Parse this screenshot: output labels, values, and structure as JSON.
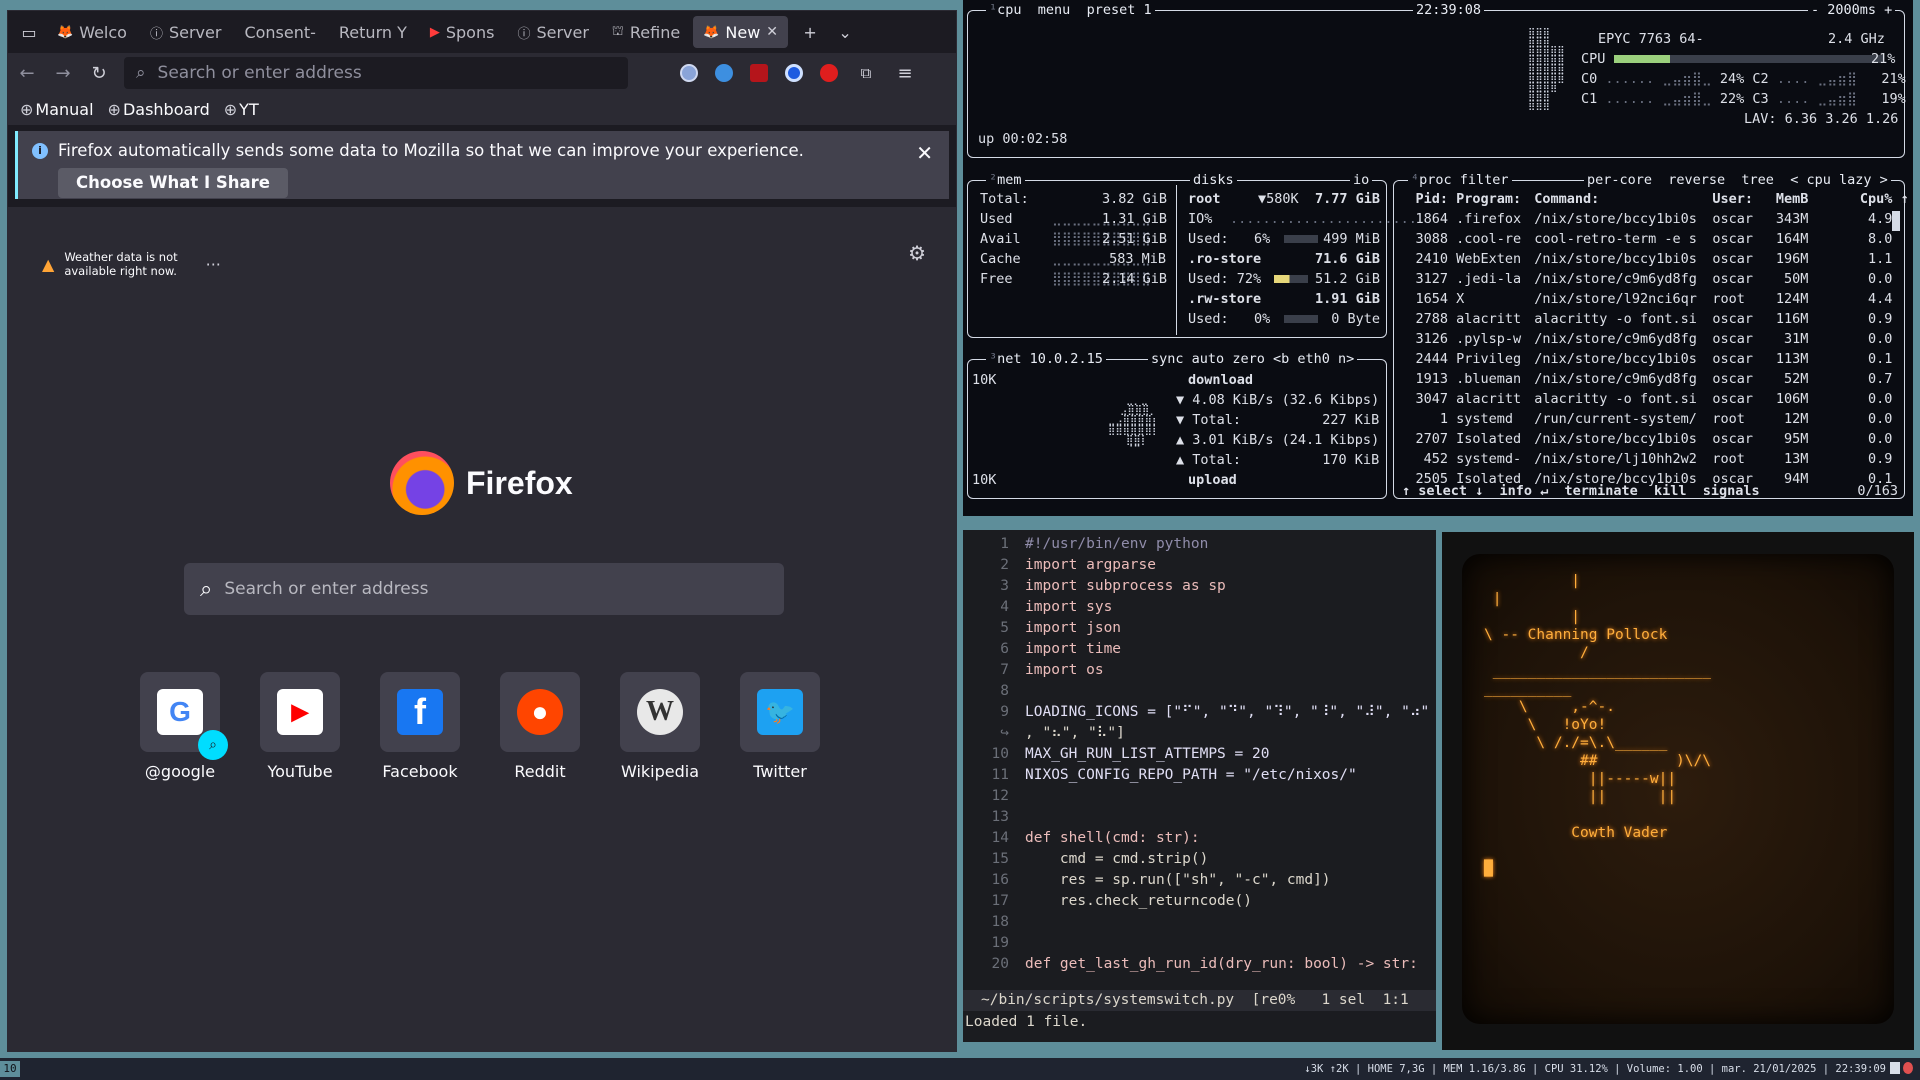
{
  "firefox": {
    "tabs": [
      {
        "label": "Welco",
        "fav": "🦊"
      },
      {
        "label": "Server",
        "fav": "ⓘ"
      },
      {
        "label": "Consent-",
        "fav": ""
      },
      {
        "label": "Return Y",
        "fav": ""
      },
      {
        "label": "Spons",
        "fav": "▶"
      },
      {
        "label": "Server",
        "fav": "ⓘ"
      },
      {
        "label": "Refine",
        "fav": "⛫"
      },
      {
        "label": "New",
        "fav": "🦊"
      }
    ],
    "url_placeholder": "Search or enter address",
    "bookmarks": [
      "Manual",
      "Dashboard",
      "YT"
    ],
    "notification": {
      "text": "Firefox automatically sends some data to Mozilla so that we can improve your experience.",
      "button": "Choose What I Share"
    },
    "weather": {
      "line1": "Weather data is not",
      "line2": "available right now."
    },
    "brand": "Firefox",
    "search_placeholder": "Search or enter address",
    "shortcuts": [
      {
        "label": "@google",
        "icon": "G",
        "color": "#ffffff",
        "fg": "#4285f4"
      },
      {
        "label": "YouTube",
        "icon": "▶",
        "color": "#ffffff",
        "fg": "#ff0000"
      },
      {
        "label": "Facebook",
        "icon": "f",
        "color": "#1877f2",
        "fg": "#ffffff"
      },
      {
        "label": "Reddit",
        "icon": "●",
        "color": "#ff4500",
        "fg": "#ffffff"
      },
      {
        "label": "Wikipedia",
        "icon": "W",
        "color": "#e8e8e8",
        "fg": "#333333"
      },
      {
        "label": "Twitter",
        "icon": "🐦",
        "color": "#1da1f2",
        "fg": "#ffffff"
      }
    ]
  },
  "btop": {
    "cpu": {
      "title": "cpu",
      "menu": "menu",
      "preset": "preset 1",
      "clock": "22:39:08",
      "refresh": "- 2000ms +",
      "model": "EPYC 7763 64-",
      "freq": "2.4 GHz",
      "total_label": "CPU",
      "total": "21%",
      "total_fill": 0.21,
      "cores": [
        {
          "name": "C0",
          "pct": "24%"
        },
        {
          "name": "C2",
          "pct": "21%"
        },
        {
          "name": "C1",
          "pct": "22%"
        },
        {
          "name": "C3",
          "pct": "19%"
        }
      ],
      "lav": "LAV: 6.36 3.26 1.26",
      "uptime": "up 00:02:58"
    },
    "mem": {
      "title": "mem",
      "rows": [
        [
          "Total:",
          "3.82 GiB"
        ],
        [
          "Used",
          "1.31 GiB"
        ],
        [
          "Avail",
          "2.51 GiB"
        ],
        [
          "Cache",
          "583 MiB"
        ],
        [
          "Free",
          "2.14 GiB"
        ]
      ]
    },
    "disks": {
      "title": "disks",
      "io": "io",
      "rows": [
        {
          "name": "root",
          "extra": "▼580K",
          "size": "7.77 GiB"
        },
        {
          "name": "IO%",
          "extra": "",
          "size": ""
        },
        {
          "name": "Used:",
          "extra": "6%",
          "size": "499 MiB"
        },
        {
          "name": ".ro-store",
          "extra": "",
          "size": "71.6 GiB"
        },
        {
          "name": "Used: 72%",
          "extra": "",
          "size": "51.2 GiB"
        },
        {
          "name": ".rw-store",
          "extra": "",
          "size": "1.91 GiB"
        },
        {
          "name": "Used:",
          "extra": "0%",
          "size": "0 Byte"
        }
      ]
    },
    "net": {
      "title": "net",
      "ip": "10.0.2.15",
      "sync": "sync",
      "auto": "auto",
      "zero": "zero",
      "iface": "<b eth0 n>",
      "top": "10K",
      "bottom": "10K",
      "lines": [
        "download",
        "▼ 4.08 KiB/s (32.6 Kibps)",
        "▼ Total:          227 KiB",
        "▲ 3.01 KiB/s (24.1 Kibps)",
        "▲ Total:          170 KiB",
        "upload"
      ]
    },
    "proc": {
      "title": "proc",
      "filter": "filter",
      "opts": "per-core  reverse  tree  < cpu lazy >",
      "header": [
        "Pid:",
        "Program:",
        "Command:",
        "User:",
        "MemB",
        "Cpu%"
      ],
      "rows": [
        [
          "1864",
          ".firefox",
          "/nix/store/bccy1bi0s",
          "oscar",
          "343M",
          "4.9"
        ],
        [
          "3088",
          ".cool-re",
          "cool-retro-term -e s",
          "oscar",
          "164M",
          "8.0"
        ],
        [
          "2410",
          "WebExten",
          "/nix/store/bccy1bi0s",
          "oscar",
          "196M",
          "1.1"
        ],
        [
          "3127",
          ".jedi-la",
          "/nix/store/c9m6yd8fg",
          "oscar",
          "50M",
          "0.0"
        ],
        [
          "1654",
          "X",
          "/nix/store/l92nci6qr",
          "root",
          "124M",
          "4.4"
        ],
        [
          "2788",
          "alacritt",
          "alacritty -o font.si",
          "oscar",
          "116M",
          "0.9"
        ],
        [
          "3126",
          ".pylsp-w",
          "/nix/store/c9m6yd8fg",
          "oscar",
          "31M",
          "0.0"
        ],
        [
          "2444",
          "Privileg",
          "/nix/store/bccy1bi0s",
          "oscar",
          "113M",
          "0.1"
        ],
        [
          "1913",
          ".blueman",
          "/nix/store/c9m6yd8fg",
          "oscar",
          "52M",
          "0.7"
        ],
        [
          "3047",
          "alacritt",
          "alacritty -o font.si",
          "oscar",
          "106M",
          "0.0"
        ],
        [
          "1",
          "systemd",
          "/run/current-system/",
          "root",
          "12M",
          "0.0"
        ],
        [
          "2707",
          "Isolated",
          "/nix/store/bccy1bi0s",
          "oscar",
          "95M",
          "0.0"
        ],
        [
          "452",
          "systemd-",
          "/nix/store/lj10hh2w2",
          "root",
          "13M",
          "0.9"
        ],
        [
          "2505",
          "Isolated",
          "/nix/store/bccy1bi0s",
          "oscar",
          "94M",
          "0.1"
        ]
      ],
      "footer": "↑ select ↓  info ↵  terminate  kill  signals",
      "count": "0/163"
    }
  },
  "helix": {
    "lines": [
      "#!/usr/bin/env python",
      "import argparse",
      "import subprocess as sp",
      "import sys",
      "import json",
      "import time",
      "import os",
      "",
      "LOADING_ICONS = [\"⠋\", \"⠙\", \"⠹\", \"⠸\", \"⠼\", \"⠴\"",
      ", \"⠦\", \"⠧\"]",
      "MAX_GH_RUN_LIST_ATTEMPS = 20",
      "NIXOS_CONFIG_REPO_PATH = \"/etc/nixos/\"",
      "",
      "",
      "def shell(cmd: str):",
      "    cmd = cmd.strip()",
      "    res = sp.run([\"sh\", \"-c\", cmd])",
      "    res.check_returncode()",
      "",
      "",
      "def get_last_gh_run_id(dry_run: bool) -> str:"
    ],
    "numbers": [
      "1",
      "2",
      "3",
      "4",
      "5",
      "6",
      "7",
      "8",
      "9",
      "↪",
      "10",
      "11",
      "12",
      "13",
      "14",
      "15",
      "16",
      "17",
      "18",
      "19",
      "20"
    ],
    "status": "~/bin/scripts/systemswitch.py  [re0%   1 sel  1:1",
    "message": "Loaded 1 file."
  },
  "crt": {
    "text": "          |\n |\n          |\n\\ -- Channing Pollock\n           /\n _________________________\n__________\n    \\     ,-^-.\n     \\   !oYo!\n      \\ /./=\\.\\______\n           ##         )\\/\\\n            ||-----w||\n            ||      ||\n\n          Cowth Vader\n\n█"
  },
  "statusbar": {
    "workspace": "10",
    "right": "↓3K ↑2K | HOME 7,3G | MEM 1.16/3.8G | CPU 31.12% | Volume: 1.00 | mar. 21/01/2025 | 22:39:09"
  }
}
